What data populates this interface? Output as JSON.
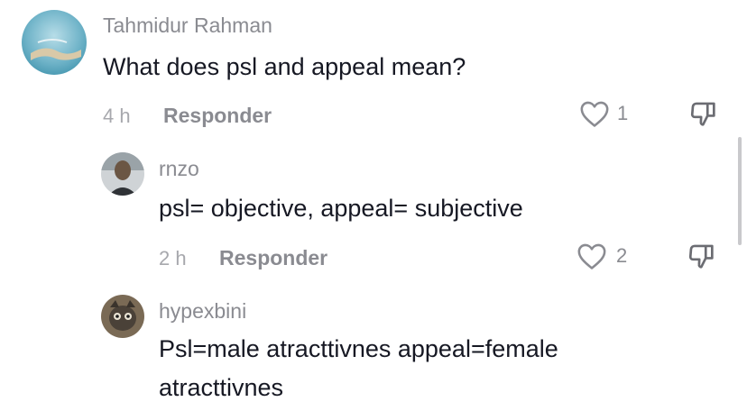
{
  "comments": [
    {
      "username": "Tahmidur Rahman",
      "text": "What does psl and appeal mean?",
      "time": "4 h",
      "reply_label": "Responder",
      "likes": "1"
    },
    {
      "username": "rnzo",
      "text": "psl= objective, appeal= subjective",
      "time": "2 h",
      "reply_label": "Responder",
      "likes": "2"
    },
    {
      "username": "hypexbini",
      "text_line1": "Psl=male atracttivnes appeal=female",
      "text_line2": "atracttivnes"
    }
  ],
  "colors": {
    "username": "#8a8b91",
    "text": "#161823",
    "meta": "#a7a8ad"
  },
  "icons": [
    "heart-outline-icon",
    "thumbs-down-icon"
  ]
}
